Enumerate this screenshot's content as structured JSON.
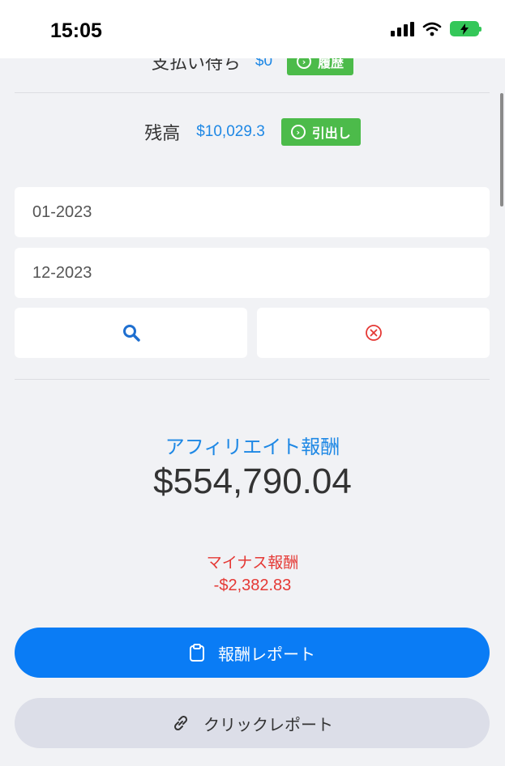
{
  "status_bar": {
    "time": "15:05"
  },
  "pending": {
    "label": "支払い待ち",
    "amount": "$0",
    "button_label": "履歴"
  },
  "balance": {
    "label": "残高",
    "amount": "$10,029.3",
    "button_label": "引出し"
  },
  "filters": {
    "start_date": "01-2023",
    "end_date": "12-2023"
  },
  "icons": {
    "search": "search-icon",
    "clear": "close-circle-icon",
    "report": "clipboard-icon",
    "click": "link-icon"
  },
  "affiliate": {
    "label": "アフィリエイト報酬",
    "amount": "$554,790.04"
  },
  "minus": {
    "label": "マイナス報酬",
    "amount": "-$2,382.83"
  },
  "buttons": {
    "report_label": "報酬レポート",
    "click_label": "クリックレポート"
  },
  "colors": {
    "accent_blue": "#0a7cf5",
    "green": "#4cbb4a",
    "negative_red": "#e53935",
    "link_blue": "#1e88e5"
  }
}
